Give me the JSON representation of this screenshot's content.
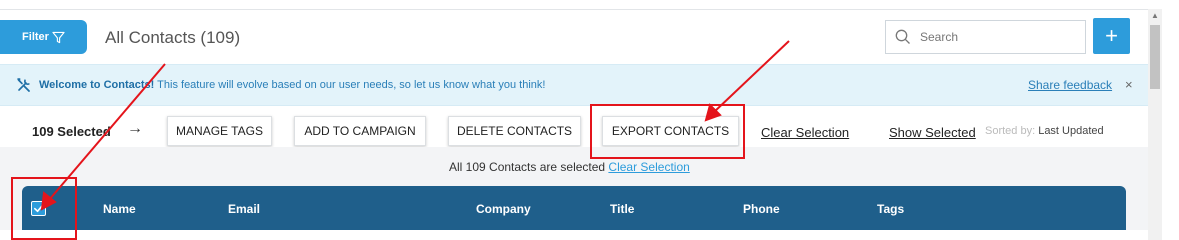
{
  "header": {
    "filter_label": "Filter",
    "title": "All Contacts (109)",
    "search_placeholder": "Search",
    "add_label": "+"
  },
  "banner": {
    "bold_text": "Welcome to Contacts!",
    "message": " This feature will evolve based on our user needs, so let us know what you think!",
    "share_feedback": "Share feedback",
    "close": "×"
  },
  "actions": {
    "selected": "109 Selected",
    "arrow": "→",
    "manage_tags": "MANAGE TAGS",
    "add_to_campaign": "ADD TO CAMPAIGN",
    "delete_contacts": "DELETE CONTACTS",
    "export_contacts": "EXPORT CONTACTS",
    "clear_selection": "Clear Selection",
    "show_selected": "Show Selected",
    "sorted_by_label": "Sorted by:",
    "sorted_by_value": " Last Updated"
  },
  "selection_notice": {
    "text": "All 109 Contacts are selected ",
    "link": "Clear Selection"
  },
  "table": {
    "columns": [
      "Name",
      "Email",
      "Company",
      "Title",
      "Phone",
      "Tags"
    ]
  },
  "colors": {
    "primary": "#2d9cdb",
    "table_header": "#1f5f8b",
    "banner_bg": "#e3f3fa",
    "annotation": "#e4141b"
  },
  "icons": [
    "filter-icon",
    "search-icon",
    "plus-icon",
    "tools-icon",
    "close-icon",
    "arrow-right-icon",
    "check-icon",
    "scroll-up-icon"
  ]
}
